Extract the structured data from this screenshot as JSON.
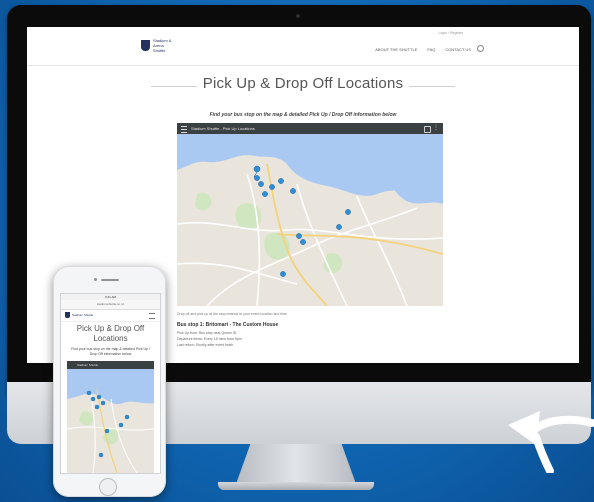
{
  "website": {
    "logo_text": "Stadium & Arena Shuttle",
    "top_link": "Login / Register",
    "nav": [
      "ABOUT THE SHUTTLE",
      "FAQ",
      "CONTACT US"
    ],
    "page_title": "Pick Up & Drop Off Locations",
    "subtitle": "Find your bus stop on the map & detailed Pick Up / Drop Off information below",
    "map_bar_title": "Stadium Shuttle - Pick Up Locations",
    "map_footer": "Drop off and pick up at the stop nearest to your event location and time.",
    "listing_title": "Bus stop 1: Britomart - The Custom House",
    "listing_lines": [
      "Pick Up from: Bus stop near Queen St",
      "Departure times: Every 15 mins from 5pm",
      "Last return: Shortly after event finish"
    ]
  },
  "phone": {
    "status": "9:41 AM",
    "url": "stadiumshuttle.co.nz",
    "logo_text": "Stadium Shuttle",
    "page_title": "Pick Up & Drop Off Locations",
    "subtitle": "Find your bus stop on the map & detailed Pick Up / Drop Off information below",
    "map_bar_title": "Stadium Shuttle"
  },
  "colors": {
    "background": "#1476c6",
    "brand_navy": "#23335e",
    "map_water": "#a9c9f3",
    "map_land": "#e9e5dc",
    "map_park": "#cfe6c0",
    "marker": "#2f8fd6"
  },
  "icons": [
    "menu-icon",
    "share-icon",
    "more-icon",
    "search-icon",
    "hamburger-icon",
    "map-marker-icon",
    "curved-arrow-icon"
  ]
}
